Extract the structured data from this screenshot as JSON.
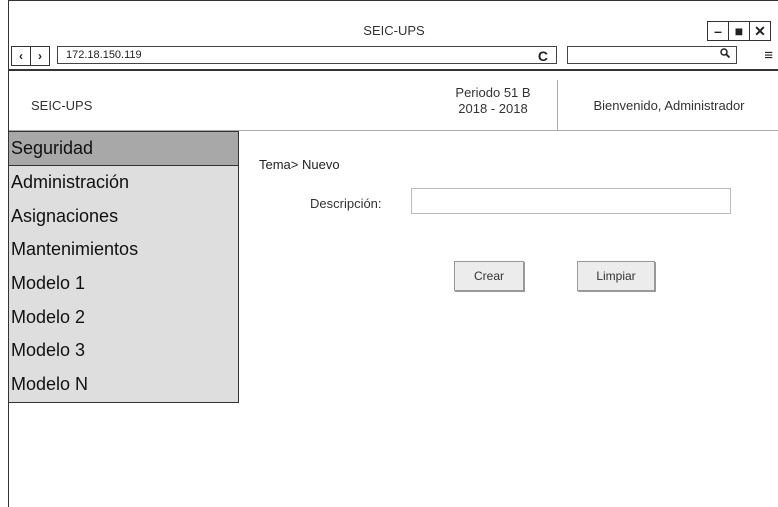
{
  "window": {
    "title": "SEIC-UPS",
    "controls": [
      "–",
      "■",
      "✕"
    ]
  },
  "addressbar": {
    "back_icon": "‹",
    "forward_icon": "›",
    "url": "172.18.150.119",
    "reload_icon": "C",
    "search_value": "",
    "search_icon": "🔍",
    "menu_icon": "≡"
  },
  "header": {
    "app_name": "SEIC-UPS",
    "period_line1": "Periodo 51 B",
    "period_line2": "2018 - 2018",
    "welcome": "Bienvenido, Administrador"
  },
  "sidebar": {
    "items": [
      {
        "label": "Seguridad",
        "active": true
      },
      {
        "label": "Administración",
        "active": false
      },
      {
        "label": "Asignaciones",
        "active": false
      },
      {
        "label": "Mantenimientos",
        "active": false
      },
      {
        "label": "Modelo 1",
        "active": false
      },
      {
        "label": "Modelo 2",
        "active": false
      },
      {
        "label": "Modelo 3",
        "active": false
      },
      {
        "label": "Modelo N",
        "active": false
      }
    ]
  },
  "main": {
    "breadcrumb": "Tema> Nuevo",
    "description_label": "Descripción:",
    "description_value": "",
    "create_label": "Crear",
    "clear_label": "Limpiar"
  }
}
